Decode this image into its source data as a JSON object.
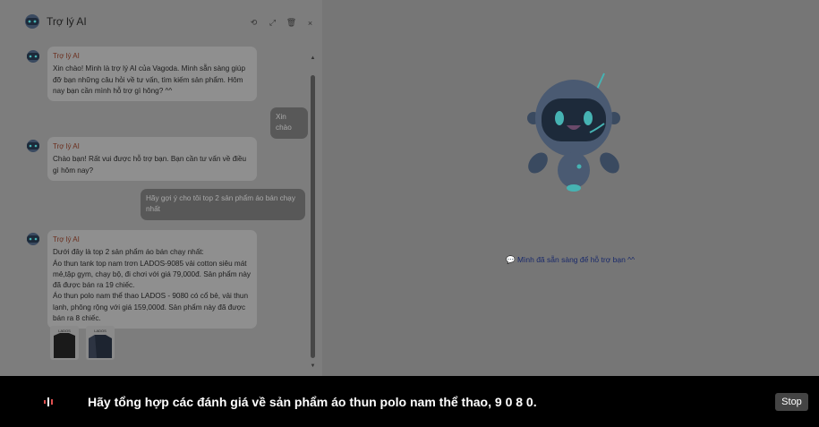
{
  "header": {
    "title": "Trợ lý AI",
    "actions": [
      "sync-icon",
      "expand-icon",
      "trash-icon",
      "close-icon"
    ]
  },
  "messages": [
    {
      "role": "bot",
      "name": "Trợ lý AI",
      "text": "Xin chào! Mình là trợ lý AI của Vagoda. Mình sẵn sàng giúp đỡ bạn những câu hỏi về tư vấn, tìm kiếm sản phẩm. Hôm nay bạn cần mình hỗ trợ gì hông? ^^"
    },
    {
      "role": "user",
      "text": "Xin chào"
    },
    {
      "role": "bot",
      "name": "Trợ lý AI",
      "text": "Chào bạn! Rất vui được hỗ trợ bạn. Bạn cần tư vấn về điều gì hôm nay?"
    },
    {
      "role": "user",
      "text": "Hãy gợi ý cho tôi top 2 sản phẩm áo bán chạy nhất"
    },
    {
      "role": "bot",
      "name": "Trợ lý AI",
      "lines": [
        "Dưới đây là top 2 sản phẩm áo bán chạy nhất:",
        "Áo thun tank top nam trơn LADOS-9085 vải cotton siêu mát mẻ,tập gym, chạy bộ, đi chơi với giá 79,000đ. Sản phẩm này đã được bán ra 19 chiếc.",
        "Áo thun polo nam thể thao LADOS - 9080 có cổ bẻ, vải thun lạnh, phông rộng với giá 159,000đ. Sản phẩm này đã được bán ra 8 chiếc."
      ]
    }
  ],
  "product_thumbs": [
    {
      "label": "LADOS",
      "color": "#1a1a1a"
    },
    {
      "label": "LADOS",
      "color": "#1d2430"
    }
  ],
  "ready_text": "💬 Mình đã sẵn sàng để hỗ trợ bạn ^^",
  "dictation": {
    "text": "Hãy tổng hợp các đánh giá về sản phẩm áo thun polo nam thể thao, 9 0 8 0.",
    "stop_label": "Stop"
  },
  "colors": {
    "overlay": "#767676",
    "bot_bubble": "#8f8f8f",
    "user_bubble": "#585858",
    "robot_body": "#40516a",
    "robot_face": "#1d2a3a",
    "robot_accent": "#46b3b3",
    "ready_text": "#1a2a6b"
  }
}
